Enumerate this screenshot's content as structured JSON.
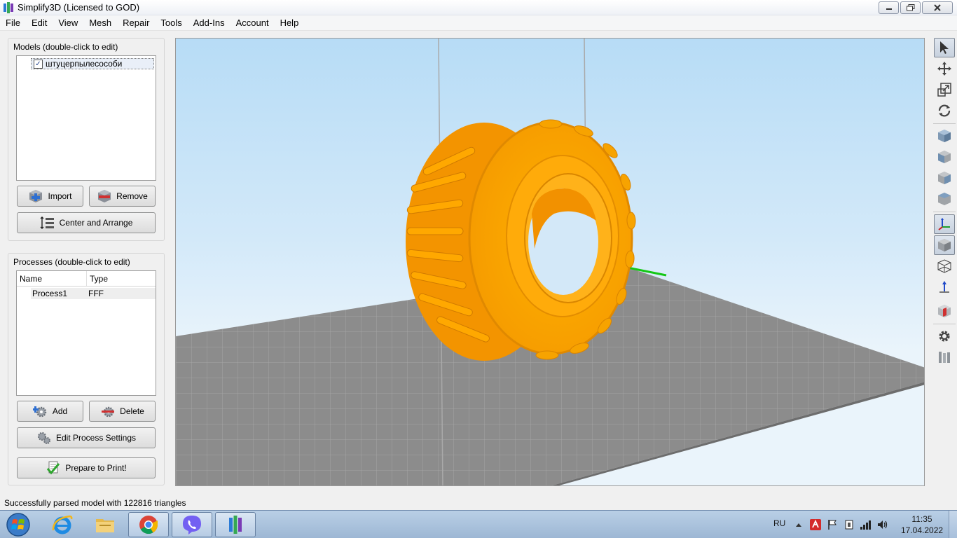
{
  "window": {
    "title": "Simplify3D (Licensed to GOD)",
    "minimize_icon": "minimize-icon",
    "restore_icon": "restore-icon",
    "close_icon": "close-icon"
  },
  "menu": {
    "items": [
      "File",
      "Edit",
      "View",
      "Mesh",
      "Repair",
      "Tools",
      "Add-Ins",
      "Account",
      "Help"
    ]
  },
  "models_panel": {
    "title": "Models (double-click to edit)",
    "items": [
      {
        "name": "штуцерпылесособи",
        "checked": true
      }
    ],
    "import_label": "Import",
    "remove_label": "Remove",
    "center_arrange_label": "Center and Arrange"
  },
  "processes_panel": {
    "title": "Processes (double-click to edit)",
    "columns": [
      "Name",
      "Type"
    ],
    "rows": [
      {
        "name": "Process1",
        "type": "FFF"
      }
    ],
    "add_label": "Add",
    "delete_label": "Delete",
    "edit_settings_label": "Edit Process Settings",
    "prepare_label": "Prepare to Print!"
  },
  "viewport": {
    "model_color": "#ffa500",
    "bed_color": "#8c8c8c",
    "sky_color": "#bfe0f7"
  },
  "toolbar_right": {
    "icons": [
      "select-arrow-icon",
      "move-icon",
      "scale-icon",
      "rotate-icon",
      "view-iso-icon",
      "view-front-icon",
      "view-side-icon",
      "view-top-icon",
      "axes-toggle-icon",
      "solid-view-icon",
      "wireframe-view-icon",
      "normals-icon",
      "cross-section-icon",
      "settings-gear-icon",
      "supports-icon"
    ]
  },
  "status": {
    "message": "Successfully parsed model with 122816 triangles"
  },
  "taskbar": {
    "apps": [
      "start-orb-icon",
      "internet-explorer-icon",
      "file-explorer-icon",
      "chrome-icon",
      "viber-icon",
      "simplify3d-icon"
    ],
    "language": "RU",
    "time": "11:35",
    "date": "17.04.2022"
  }
}
